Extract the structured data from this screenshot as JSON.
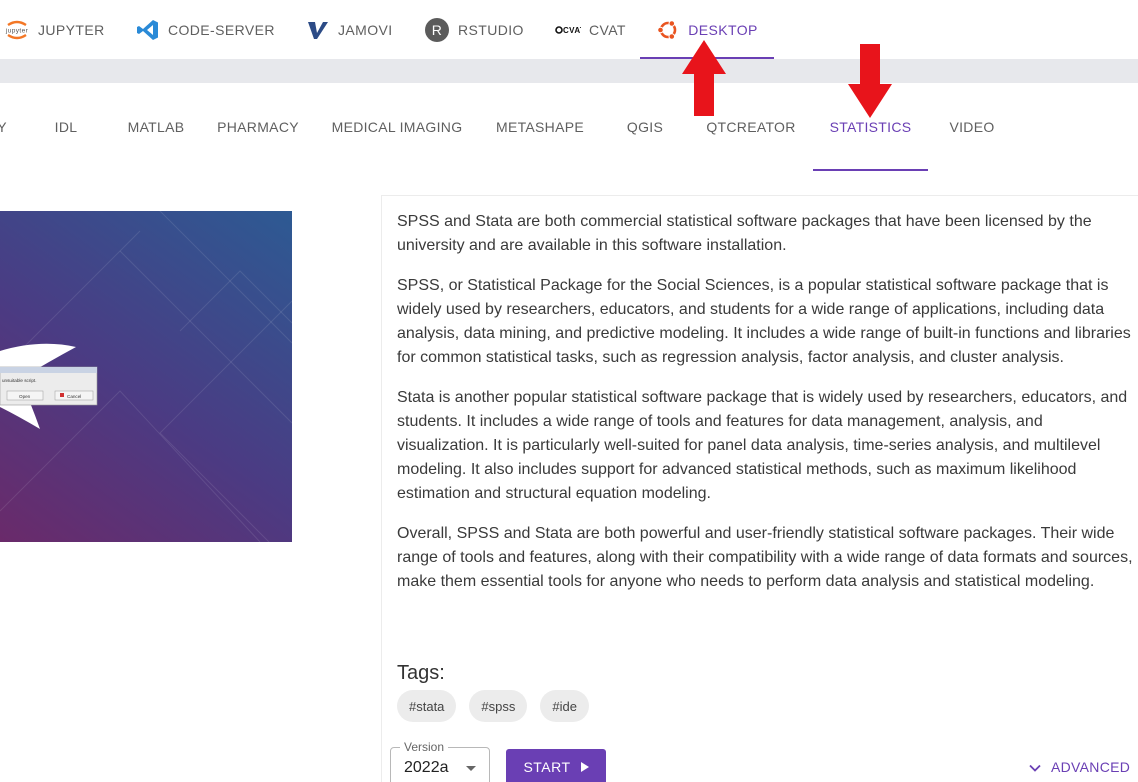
{
  "top_tabs": [
    {
      "label": "JUPYTER",
      "icon": "jupyter-icon"
    },
    {
      "label": "CODE-SERVER",
      "icon": "vscode-icon"
    },
    {
      "label": "JAMOVI",
      "icon": "jamovi-icon"
    },
    {
      "label": "RSTUDIO",
      "icon": "rstudio-icon"
    },
    {
      "label": "CVAT",
      "icon": "cvat-icon"
    },
    {
      "label": "DESKTOP",
      "icon": "ubuntu-icon",
      "active": true
    }
  ],
  "logos": {
    "jupyter_text": "jupyter",
    "rstudio_letter": "R",
    "cvat_text": "CVAT"
  },
  "category_tabs": [
    {
      "label": "IDL"
    },
    {
      "label": "MATLAB"
    },
    {
      "label": "PHARMACY"
    },
    {
      "label": "MEDICAL IMAGING"
    },
    {
      "label": "METASHAPE"
    },
    {
      "label": "QGIS"
    },
    {
      "label": "QTCREATOR"
    },
    {
      "label": "STATISTICS",
      "active": true
    },
    {
      "label": "VIDEO"
    }
  ],
  "preview": {
    "dialog_message": "unsuitable script.",
    "open_label": "Open",
    "cancel_label": "Cancel"
  },
  "description": {
    "paragraphs": [
      "SPSS and Stata are both commercial statistical software packages that have been licensed by the university and are available in this software installation.",
      "SPSS, or Statistical Package for the Social Sciences, is a popular statistical software package that is widely used by researchers, educators, and students for a wide range of applications, including data analysis, data mining, and predictive modeling. It includes a wide range of built-in functions and libraries for common statistical tasks, such as regression analysis, factor analysis, and cluster analysis.",
      "Stata is another popular statistical software package that is widely used by researchers, educators, and students. It includes a wide range of tools and features for data management, analysis, and visualization. It is particularly well-suited for panel data analysis, time-series analysis, and multilevel modeling. It also includes support for advanced statistical methods, such as maximum likelihood estimation and structural equation modeling.",
      "Overall, SPSS and Stata are both powerful and user-friendly statistical software packages. Their wide range of tools and features, along with their compatibility with a wide range of data formats and sources, make them essential tools for anyone who needs to perform data analysis and statistical modeling."
    ]
  },
  "tags": {
    "title": "Tags:",
    "items": [
      "#stata",
      "#spss",
      "#ide"
    ]
  },
  "controls": {
    "version_label": "Version",
    "version_value": "2022a",
    "start_label": "START",
    "advanced_label": "ADVANCED"
  },
  "colors": {
    "accent": "#6a3fb4",
    "annotation_arrow": "#e8141b",
    "preview_gradient_start": "#6a2a6a",
    "preview_gradient_end": "#2d5a93"
  }
}
